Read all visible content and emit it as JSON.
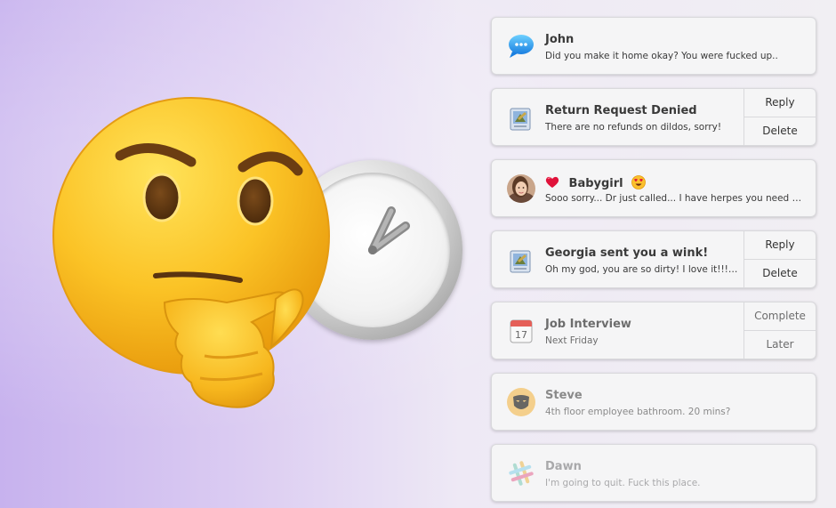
{
  "notifications": [
    {
      "app_icon": "messages-icon",
      "title": "John",
      "body": "Did you make it home okay? You were fucked up.."
    },
    {
      "app_icon": "mail-icon",
      "title": "Return Request Denied",
      "body": "There are no refunds on dildos, sorry!",
      "actions": [
        "Reply",
        "Delete"
      ]
    },
    {
      "app_icon": "avatar-photo",
      "title_prefix_icon": "heart-icon",
      "title": "Babygirl",
      "title_suffix_icon": "heart-eyes-emoji-icon",
      "body": "Sooo sorry... Dr just called... I have herpes you need t..."
    },
    {
      "app_icon": "mail-icon",
      "title": "Georgia sent you a wink!",
      "body": "Oh my god, you are so dirty! I love it!!!!!...",
      "actions": [
        "Reply",
        "Delete"
      ]
    },
    {
      "app_icon": "calendar-icon",
      "calendar_day": "17",
      "title": "Job Interview",
      "body": "Next Friday",
      "actions": [
        "Complete",
        "Later"
      ]
    },
    {
      "app_icon": "grindr-mask-icon",
      "title": "Steve",
      "body": "4th floor employee bathroom. 20 mins?"
    },
    {
      "app_icon": "slack-icon",
      "title": "Dawn",
      "body": "I'm going to quit. Fuck this place."
    }
  ],
  "illustration": {
    "emoji": "thinking-face-emoji",
    "clock": "clock-icon"
  },
  "colors": {
    "background_left": "#c7b2ee",
    "background_right": "#f1eff3",
    "emoji_yellow": "#f7b51e",
    "card_background": "#f5f5f6",
    "card_border": "#d9d9dc",
    "text": "#3a3a3a"
  }
}
